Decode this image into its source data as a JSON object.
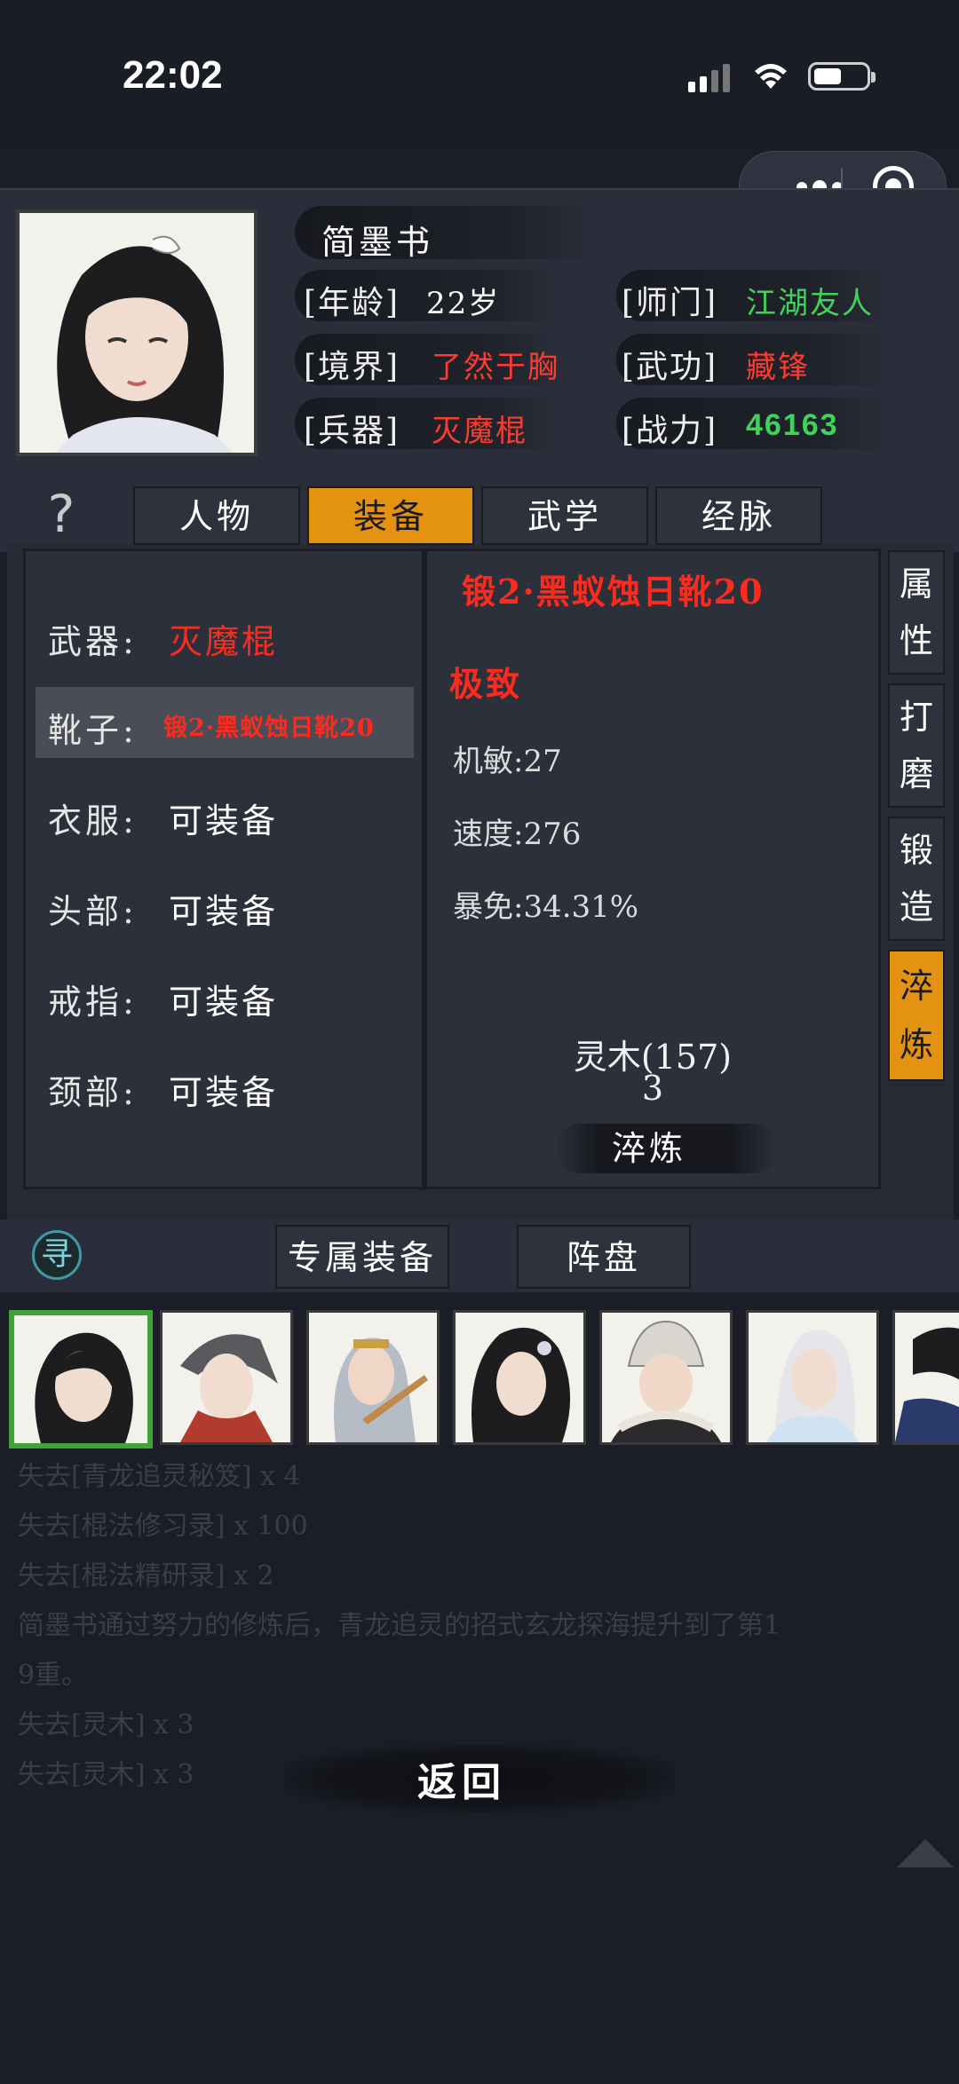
{
  "status_bar": {
    "time": "22:02"
  },
  "header": {
    "name": "简墨书",
    "fields": [
      {
        "label": "[年龄]",
        "value": "22岁",
        "color": "#ffffff"
      },
      {
        "label": "[境界]",
        "value": "了然于胸",
        "color": "#ff3b2f"
      },
      {
        "label": "[兵器]",
        "value": "灭魔棍",
        "color": "#ff3b2f"
      },
      {
        "label": "[师门]",
        "value": "江湖友人",
        "color": "#3fd35a"
      },
      {
        "label": "[武功]",
        "value": "藏锋",
        "color": "#ff3b2f"
      },
      {
        "label": "[战力]",
        "value": "46163",
        "color": "#3fd35a"
      }
    ]
  },
  "tabs": [
    "人物",
    "装备",
    "武学",
    "经脉"
  ],
  "active_tab": "装备",
  "equipment": [
    {
      "label": "武器:",
      "value": "灭魔棍",
      "color": "#ff2a1e"
    },
    {
      "label": "靴子:",
      "value": "锻2·黑蚁蚀日靴20",
      "color": "#ff2a1e",
      "selected": true
    },
    {
      "label": "衣服:",
      "value": "可装备",
      "color": "#ffffff"
    },
    {
      "label": "头部:",
      "value": "可装备",
      "color": "#ffffff"
    },
    {
      "label": "戒指:",
      "value": "可装备",
      "color": "#ffffff"
    },
    {
      "label": "颈部:",
      "value": "可装备",
      "color": "#ffffff"
    }
  ],
  "item_detail": {
    "title": "锻2·黑蚁蚀日靴20",
    "quality": "极致",
    "stats": [
      "机敏:27",
      "速度:276",
      "暴免:34.31%"
    ],
    "material": "灵木(157)",
    "material_count": "3",
    "action_label": "淬炼"
  },
  "side_tabs": [
    {
      "label": "属性"
    },
    {
      "label": "打磨"
    },
    {
      "label": "锻造"
    },
    {
      "label": "淬炼",
      "active": true
    }
  ],
  "bottom_tabs": {
    "seek_icon": "寻",
    "exclusive": "专属装备",
    "formation": "阵盘"
  },
  "log_lines": [
    "失去[青龙追灵秘笈] x 4",
    "失去[棍法修习录] x 100",
    "失去[棍法精研录] x 2",
    "简墨书通过努力的修炼后，青龙追灵的招式玄龙探海提升到了第1",
    "9重。",
    "失去[灵木] x 3",
    "失去[灵木] x 3"
  ],
  "back_label": "返回"
}
